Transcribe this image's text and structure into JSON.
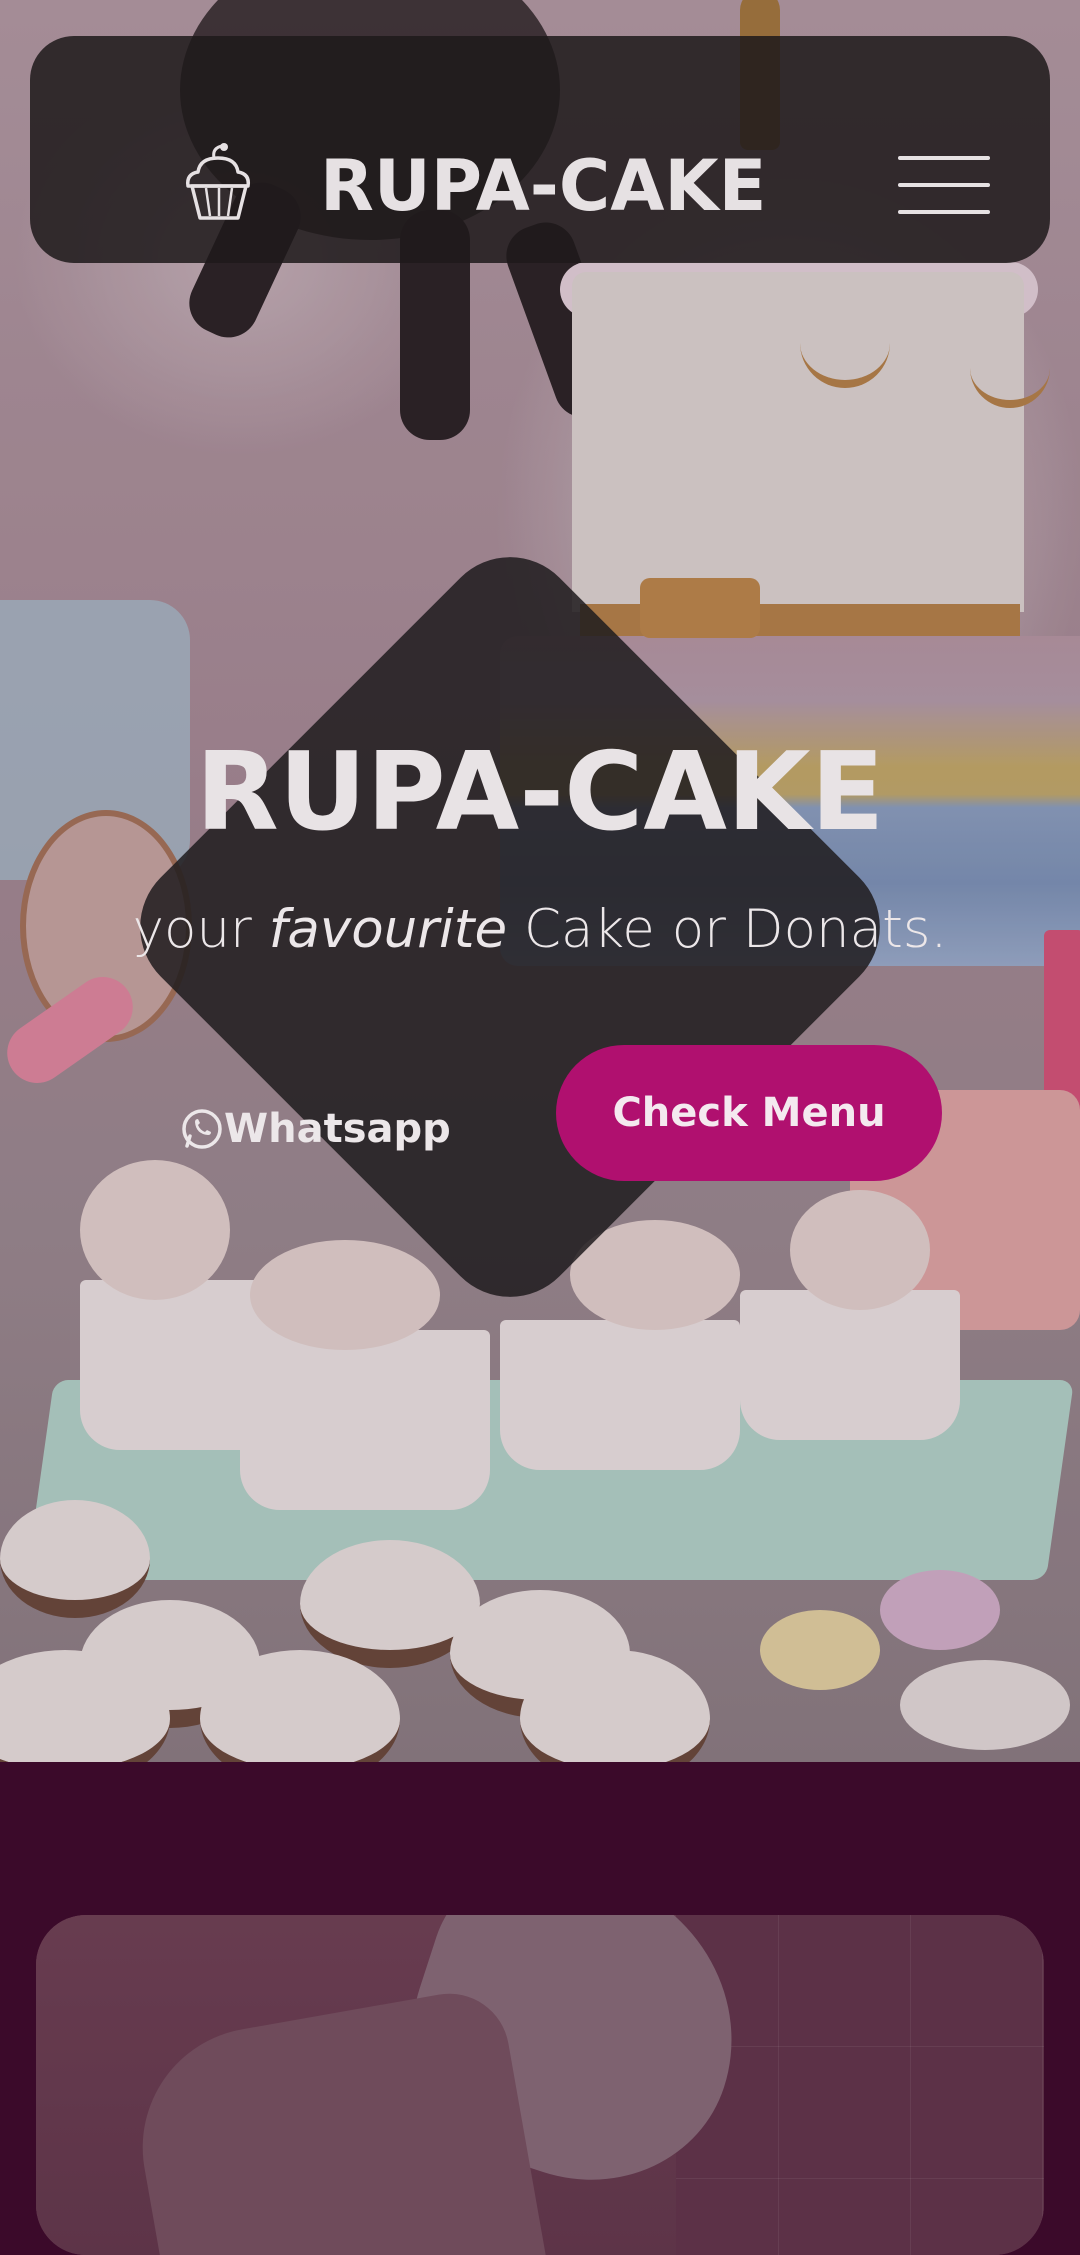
{
  "navbar": {
    "logo_icon": "cupcake-icon",
    "brand": "RUPA-CAKE",
    "menu_icon": "hamburger-menu-icon"
  },
  "hero": {
    "title": "RUPA-CAKE",
    "subtitle_before": "your ",
    "subtitle_emphasis": "favourite",
    "subtitle_after": " Cake or Donats.",
    "whatsapp_icon": "whatsapp-icon",
    "whatsapp_label": "Whatsapp",
    "check_menu_label": "Check Menu"
  },
  "colors": {
    "accent": "#b0106f",
    "section_bg": "#3b0a2a",
    "overlay": "#201c1e",
    "text_light": "#e8e3e5"
  }
}
